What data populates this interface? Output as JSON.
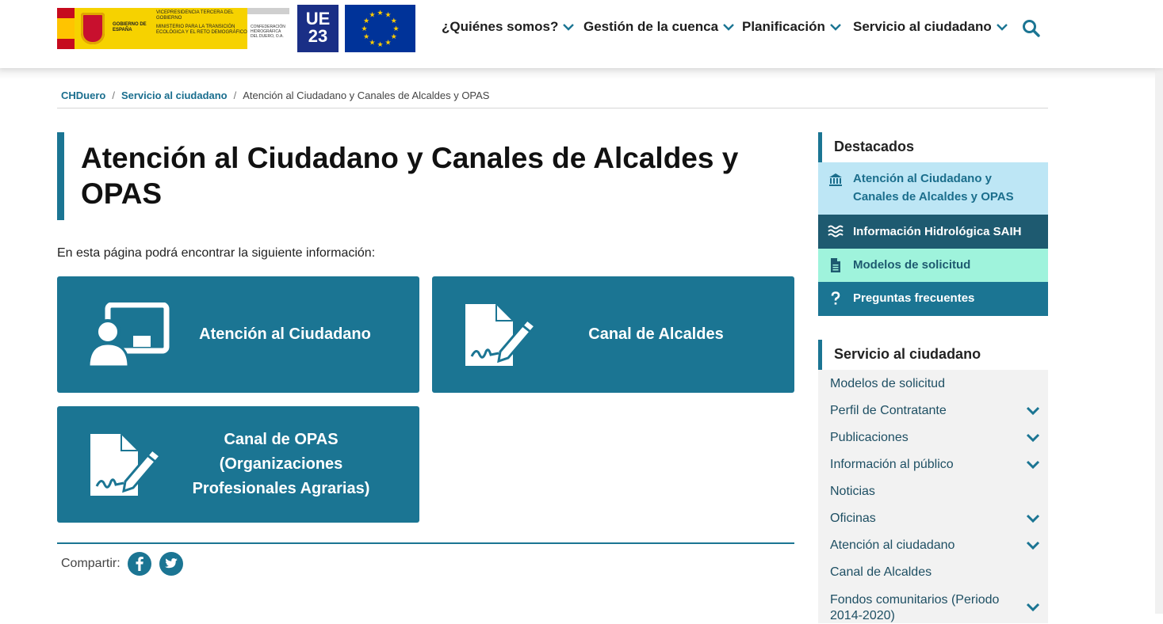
{
  "header": {
    "gov_logo": {
      "line1": "GOBIERNO DE ESPAÑA",
      "line2": "VICEPRESIDENCIA TERCERA DEL GOBIERNO",
      "line3": "MINISTERIO PARA LA TRANSICIÓN ECOLÓGICA Y EL RETO DEMOGRÁFICO",
      "line4": "CONFEDERACIÓN HIDROGRÁFICA DEL DUERO, O.A."
    },
    "ue_logo": {
      "top": "UE",
      "bottom": "23"
    },
    "nav": [
      {
        "label": "¿Quiénes somos?"
      },
      {
        "label": "Gestión de la cuenca"
      },
      {
        "label": "Planificación"
      },
      {
        "label": "Servicio al ciudadano"
      }
    ]
  },
  "breadcrumb": {
    "items": [
      "CHDuero",
      "Servicio al ciudadano"
    ],
    "current": "Atención al Ciudadano y Canales de Alcaldes y OPAS"
  },
  "main": {
    "title": "Atención al Ciudadano y Canales de Alcaldes y OPAS",
    "intro": "En esta página podrá encontrar la siguiente información:",
    "cards": [
      {
        "label": "Atención al Ciudadano",
        "icon": "citizen-icon"
      },
      {
        "label": "Canal de Alcaldes",
        "icon": "document-sign-icon"
      },
      {
        "label": "Canal de OPAS (Organizaciones Profesionales Agrarias)",
        "icon": "document-sign-icon"
      }
    ],
    "share_label": "Compartir:"
  },
  "sidebar": {
    "destacados_title": "Destacados",
    "destacados": [
      {
        "label": "Atención al Ciudadano y Canales de Alcaldes y OPAS",
        "icon": "institution-icon"
      },
      {
        "label": "Información Hidrológica SAIH",
        "icon": "water-icon"
      },
      {
        "label": "Modelos de solicitud",
        "icon": "file-icon"
      },
      {
        "label": "Preguntas frecuentes",
        "icon": "question-icon"
      }
    ],
    "servicio_title": "Servicio al ciudadano",
    "servicio": [
      {
        "label": "Modelos de solicitud",
        "expandable": false
      },
      {
        "label": "Perfil de Contratante",
        "expandable": true
      },
      {
        "label": "Publicaciones",
        "expandable": true
      },
      {
        "label": "Información al público",
        "expandable": true
      },
      {
        "label": "Noticias",
        "expandable": false
      },
      {
        "label": "Oficinas",
        "expandable": true
      },
      {
        "label": "Atención al ciudadano",
        "expandable": true
      },
      {
        "label": "Canal de Alcaldes",
        "expandable": false
      },
      {
        "label": "Fondos comunitarios (Periodo 2014-2020)",
        "expandable": true
      }
    ]
  },
  "colors": {
    "primary": "#1b7593",
    "dest_active": "#bde6f5",
    "dest_dark": "#1e5a70",
    "dest_green": "#9ff3dc"
  }
}
